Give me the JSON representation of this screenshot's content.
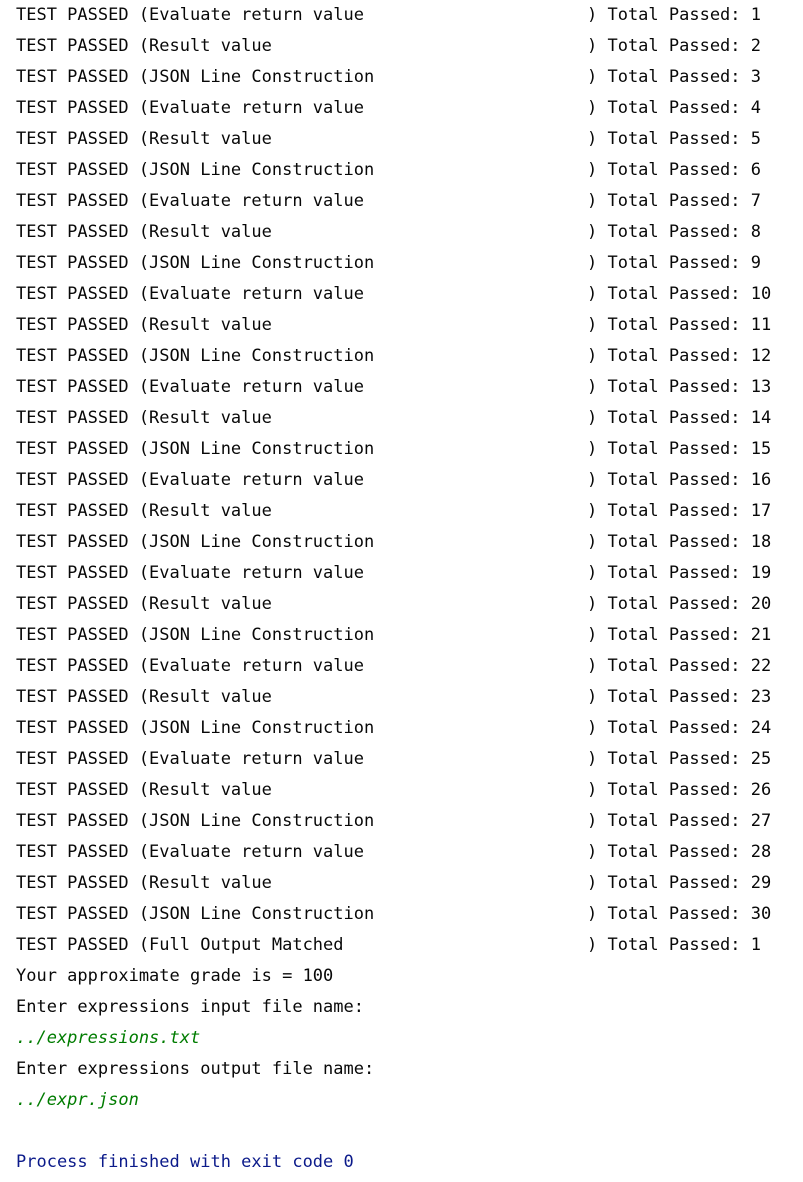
{
  "tests": [
    {
      "label": "TEST PASSED (Evaluate return value",
      "total": ") Total Passed: 1"
    },
    {
      "label": "TEST PASSED (Result value",
      "total": ") Total Passed: 2"
    },
    {
      "label": "TEST PASSED (JSON Line Construction",
      "total": ") Total Passed: 3"
    },
    {
      "label": "TEST PASSED (Evaluate return value",
      "total": ") Total Passed: 4"
    },
    {
      "label": "TEST PASSED (Result value",
      "total": ") Total Passed: 5"
    },
    {
      "label": "TEST PASSED (JSON Line Construction",
      "total": ") Total Passed: 6"
    },
    {
      "label": "TEST PASSED (Evaluate return value",
      "total": ") Total Passed: 7"
    },
    {
      "label": "TEST PASSED (Result value",
      "total": ") Total Passed: 8"
    },
    {
      "label": "TEST PASSED (JSON Line Construction",
      "total": ") Total Passed: 9"
    },
    {
      "label": "TEST PASSED (Evaluate return value",
      "total": ") Total Passed: 10"
    },
    {
      "label": "TEST PASSED (Result value",
      "total": ") Total Passed: 11"
    },
    {
      "label": "TEST PASSED (JSON Line Construction",
      "total": ") Total Passed: 12"
    },
    {
      "label": "TEST PASSED (Evaluate return value",
      "total": ") Total Passed: 13"
    },
    {
      "label": "TEST PASSED (Result value",
      "total": ") Total Passed: 14"
    },
    {
      "label": "TEST PASSED (JSON Line Construction",
      "total": ") Total Passed: 15"
    },
    {
      "label": "TEST PASSED (Evaluate return value",
      "total": ") Total Passed: 16"
    },
    {
      "label": "TEST PASSED (Result value",
      "total": ") Total Passed: 17"
    },
    {
      "label": "TEST PASSED (JSON Line Construction",
      "total": ") Total Passed: 18"
    },
    {
      "label": "TEST PASSED (Evaluate return value",
      "total": ") Total Passed: 19"
    },
    {
      "label": "TEST PASSED (Result value",
      "total": ") Total Passed: 20"
    },
    {
      "label": "TEST PASSED (JSON Line Construction",
      "total": ") Total Passed: 21"
    },
    {
      "label": "TEST PASSED (Evaluate return value",
      "total": ") Total Passed: 22"
    },
    {
      "label": "TEST PASSED (Result value",
      "total": ") Total Passed: 23"
    },
    {
      "label": "TEST PASSED (JSON Line Construction",
      "total": ") Total Passed: 24"
    },
    {
      "label": "TEST PASSED (Evaluate return value",
      "total": ") Total Passed: 25"
    },
    {
      "label": "TEST PASSED (Result value",
      "total": ") Total Passed: 26"
    },
    {
      "label": "TEST PASSED (JSON Line Construction",
      "total": ") Total Passed: 27"
    },
    {
      "label": "TEST PASSED (Evaluate return value",
      "total": ") Total Passed: 28"
    },
    {
      "label": "TEST PASSED (Result value",
      "total": ") Total Passed: 29"
    },
    {
      "label": "TEST PASSED (JSON Line Construction",
      "total": ") Total Passed: 30"
    },
    {
      "label": "TEST PASSED (Full Output Matched",
      "total": ") Total Passed: 1"
    }
  ],
  "grade_line": "Your approximate grade is = 100",
  "input_prompt": "Enter expressions input file name:",
  "input_value": "../expressions.txt",
  "output_prompt": "Enter expressions output file name:",
  "output_value": "../expr.json",
  "exit_message": "Process finished with exit code 0",
  "colors": {
    "text": "#080808",
    "user_input": "#007c00",
    "exit_message": "#0b1a8a",
    "background": "#ffffff"
  }
}
